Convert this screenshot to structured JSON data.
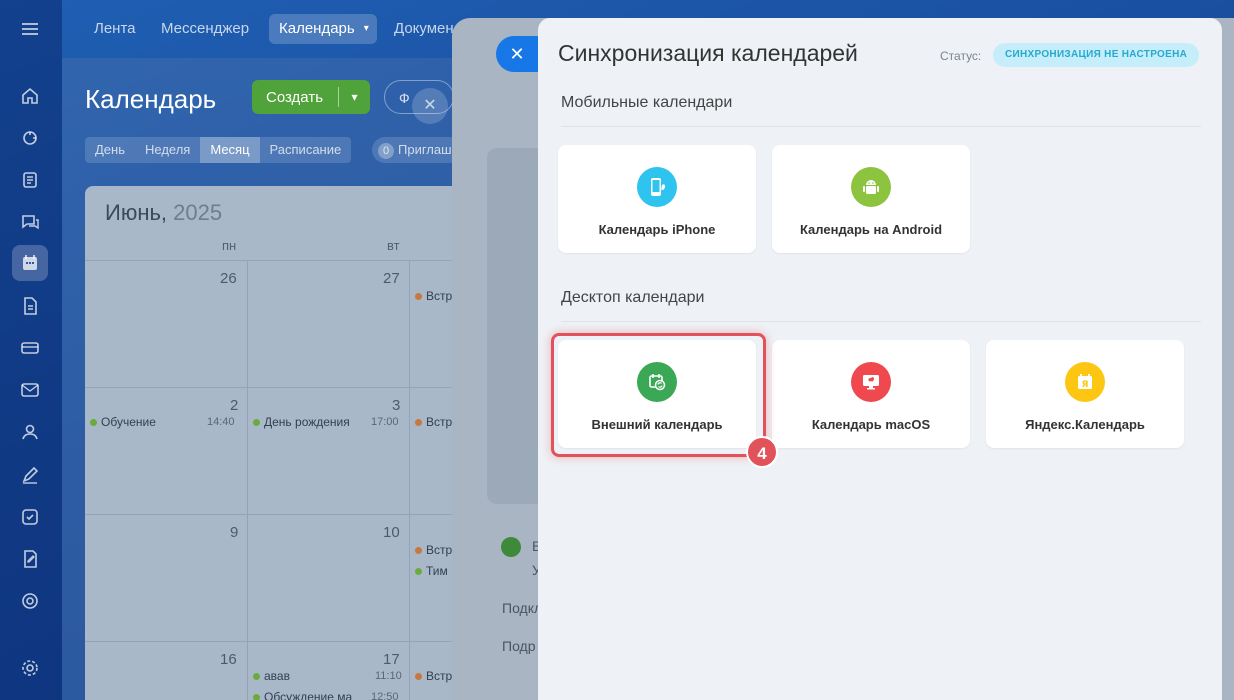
{
  "topnav": {
    "tabs": [
      {
        "label": "Лента"
      },
      {
        "label": "Мессенджер"
      },
      {
        "label": "Календарь"
      },
      {
        "label": "Докумен"
      }
    ]
  },
  "calendar_page": {
    "title": "Календарь",
    "create_label": "Создать",
    "filter_text": "Ф",
    "views": [
      "День",
      "Неделя",
      "Месяц",
      "Расписание"
    ],
    "active_view": "Месяц",
    "invites_count": "0",
    "invites_label": "Приглаш",
    "month": "Июнь,",
    "year": "2025",
    "weekdays": [
      "пн",
      "вт"
    ],
    "days": {
      "d26": "26",
      "d27": "27",
      "d2": "2",
      "d3": "3",
      "d9": "9",
      "d10": "10",
      "d16": "16",
      "d17": "17"
    },
    "events": {
      "e1": "Обучение",
      "e1_time": "14:40",
      "e2": "День рождения",
      "e2_time": "17:00",
      "e3": "авав",
      "e3_time": "11:10",
      "e4": "Обсуждение ма",
      "e4_time": "12:50",
      "col3_a": "Встр",
      "col3_b": "Встр",
      "col3_c": "Встр",
      "col3_d": "Тим",
      "col3_e": "Встр"
    }
  },
  "background_panel": {
    "text1": "В",
    "text2": "У",
    "link1": "Подкл",
    "link2": "Подр"
  },
  "dialog": {
    "title": "Синхронизация календарей",
    "status_label": "Статус:",
    "status_value": "СИНХРОНИЗАЦИЯ НЕ НАСТРОЕНА",
    "mobile_section": "Мобильные календари",
    "desktop_section": "Десктоп календари",
    "mobile_cards": [
      {
        "label": "Календарь iPhone",
        "icon": "iphone-icon",
        "color": "#2fc4ef"
      },
      {
        "label": "Календарь на Android",
        "icon": "android-icon",
        "color": "#8cc43f"
      }
    ],
    "desktop_cards": [
      {
        "label": "Внешний календарь",
        "icon": "sync-calendar-icon",
        "color": "#3aa855"
      },
      {
        "label": "Календарь macOS",
        "icon": "apple-icon",
        "color": "#f0484f"
      },
      {
        "label": "Яндекс.Календарь",
        "icon": "yandex-calendar-icon",
        "color": "#fdc613"
      }
    ],
    "step_badge": "4"
  },
  "colors": {
    "accent": "#1877e6",
    "create_button": "#4fa33a",
    "highlight": "#e2525b",
    "status_bg": "#c5eefa",
    "status_text": "#25a9cf"
  }
}
